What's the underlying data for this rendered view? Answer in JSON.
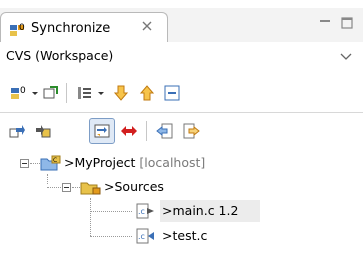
{
  "tab": {
    "label": "Synchronize",
    "icon": "synchronize-icon",
    "close_icon": "close-x-icon"
  },
  "window_controls": [
    "minimize-icon",
    "maximize-icon"
  ],
  "title": {
    "text": "CVS (Workspace)",
    "menu_icon": "view-menu-arrow-icon"
  },
  "toolbar1": {
    "items": [
      "synchronize-dropdown-icon",
      "pin-icon",
      "layout-dropdown-icon",
      "next-difference-icon",
      "previous-difference-icon",
      "collapse-all-icon"
    ]
  },
  "toolbar2": {
    "items": [
      "incoming-mode-icon",
      "outgoing-mode-icon",
      "incoming-outgoing-mode-icon",
      "conflicts-mode-icon",
      "update-all-icon",
      "commit-all-icon"
    ]
  },
  "tree": {
    "project": {
      "prefix": ">",
      "name": "MyProject",
      "repo": "[localhost]"
    },
    "folder": {
      "prefix": ">",
      "name": "Sources"
    },
    "files": [
      {
        "prefix": ">",
        "name": "main.c",
        "revision": "1.2"
      },
      {
        "prefix": ">",
        "name": "test.c",
        "revision": ""
      }
    ]
  },
  "colors": {
    "accent_blue": "#3a6fb6",
    "folder_yellow": "#e8c24a",
    "arrow_orange": "#e39a1c",
    "conflict_red": "#d21f1f"
  }
}
